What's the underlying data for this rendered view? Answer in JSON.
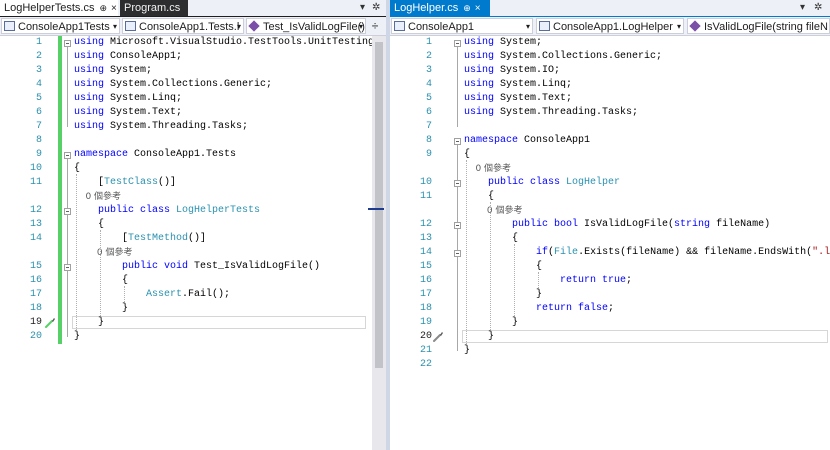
{
  "left_pane": {
    "tabs": [
      {
        "label": "LogHelperTests.cs",
        "active": true
      },
      {
        "label": "Program.cs",
        "active": false
      }
    ],
    "nav": {
      "project": "ConsoleApp1Tests",
      "type": "ConsoleApp1.Tests.l",
      "member": "Test_IsValidLogFile()"
    },
    "lines": [
      {
        "n": "1",
        "tokens": [
          {
            "k": "kw",
            "t": "using"
          },
          {
            "k": "p",
            "t": " Microsoft.VisualStudio.TestTools.UnitTesting;"
          }
        ]
      },
      {
        "n": "2",
        "tokens": [
          {
            "k": "kw",
            "t": "using"
          },
          {
            "k": "p",
            "t": " ConsoleApp1;"
          }
        ]
      },
      {
        "n": "3",
        "tokens": [
          {
            "k": "kw",
            "t": "using"
          },
          {
            "k": "p",
            "t": " System;"
          }
        ]
      },
      {
        "n": "4",
        "tokens": [
          {
            "k": "kw",
            "t": "using"
          },
          {
            "k": "p",
            "t": " System.Collections.Generic;"
          }
        ]
      },
      {
        "n": "5",
        "tokens": [
          {
            "k": "kw",
            "t": "using"
          },
          {
            "k": "p",
            "t": " System.Linq;"
          }
        ]
      },
      {
        "n": "6",
        "tokens": [
          {
            "k": "kw",
            "t": "using"
          },
          {
            "k": "p",
            "t": " System.Text;"
          }
        ]
      },
      {
        "n": "7",
        "tokens": [
          {
            "k": "kw",
            "t": "using"
          },
          {
            "k": "p",
            "t": " System.Threading.Tasks;"
          }
        ]
      },
      {
        "n": "8",
        "tokens": []
      },
      {
        "n": "9",
        "tokens": [
          {
            "k": "kw",
            "t": "namespace"
          },
          {
            "k": "p",
            "t": " ConsoleApp1.Tests"
          }
        ]
      },
      {
        "n": "10",
        "tokens": [
          {
            "k": "p",
            "t": "{"
          }
        ]
      },
      {
        "n": "11",
        "tokens": [
          {
            "k": "p",
            "t": "    ["
          },
          {
            "k": "ty",
            "t": "TestClass"
          },
          {
            "k": "p",
            "t": "()]"
          }
        ]
      },
      {
        "n": "",
        "tokens": [
          {
            "k": "ref",
            "t": "    0 個參考"
          }
        ]
      },
      {
        "n": "12",
        "tokens": [
          {
            "k": "p",
            "t": "    "
          },
          {
            "k": "kw",
            "t": "public class"
          },
          {
            "k": "p",
            "t": " "
          },
          {
            "k": "ty",
            "t": "LogHelperTests"
          }
        ]
      },
      {
        "n": "13",
        "tokens": [
          {
            "k": "p",
            "t": "    {"
          }
        ]
      },
      {
        "n": "14",
        "tokens": [
          {
            "k": "p",
            "t": "        ["
          },
          {
            "k": "ty",
            "t": "TestMethod"
          },
          {
            "k": "p",
            "t": "()]"
          }
        ]
      },
      {
        "n": "",
        "tokens": [
          {
            "k": "ref",
            "t": "        0 個參考"
          }
        ]
      },
      {
        "n": "15",
        "tokens": [
          {
            "k": "p",
            "t": "        "
          },
          {
            "k": "kw",
            "t": "public void"
          },
          {
            "k": "p",
            "t": " Test_IsValidLogFile()"
          }
        ]
      },
      {
        "n": "16",
        "tokens": [
          {
            "k": "p",
            "t": "        {"
          }
        ]
      },
      {
        "n": "17",
        "tokens": [
          {
            "k": "p",
            "t": "            "
          },
          {
            "k": "ty",
            "t": "Assert"
          },
          {
            "k": "p",
            "t": ".Fail();"
          }
        ]
      },
      {
        "n": "18",
        "tokens": [
          {
            "k": "p",
            "t": "        }"
          }
        ]
      },
      {
        "n": "19",
        "tokens": [
          {
            "k": "p",
            "t": "    }"
          }
        ]
      },
      {
        "n": "20",
        "tokens": [
          {
            "k": "p",
            "t": "}"
          }
        ]
      }
    ]
  },
  "right_pane": {
    "tabs": [
      {
        "label": "LogHelper.cs",
        "active": true
      }
    ],
    "nav": {
      "project": "ConsoleApp1",
      "type": "ConsoleApp1.LogHelper",
      "member": "IsValidLogFile(string fileN"
    },
    "lines": [
      {
        "n": "1",
        "tokens": [
          {
            "k": "kw",
            "t": "using"
          },
          {
            "k": "p",
            "t": " System;"
          }
        ]
      },
      {
        "n": "2",
        "tokens": [
          {
            "k": "kw",
            "t": "using"
          },
          {
            "k": "p",
            "t": " System.Collections.Generic;"
          }
        ]
      },
      {
        "n": "3",
        "tokens": [
          {
            "k": "kw",
            "t": "using"
          },
          {
            "k": "p",
            "t": " System.IO;"
          }
        ]
      },
      {
        "n": "4",
        "tokens": [
          {
            "k": "kw",
            "t": "using"
          },
          {
            "k": "p",
            "t": " System.Linq;"
          }
        ]
      },
      {
        "n": "5",
        "tokens": [
          {
            "k": "kw",
            "t": "using"
          },
          {
            "k": "p",
            "t": " System.Text;"
          }
        ]
      },
      {
        "n": "6",
        "tokens": [
          {
            "k": "kw",
            "t": "using"
          },
          {
            "k": "p",
            "t": " System.Threading.Tasks;"
          }
        ]
      },
      {
        "n": "7",
        "tokens": []
      },
      {
        "n": "8",
        "tokens": [
          {
            "k": "kw",
            "t": "namespace"
          },
          {
            "k": "p",
            "t": " ConsoleApp1"
          }
        ]
      },
      {
        "n": "9",
        "tokens": [
          {
            "k": "p",
            "t": "{"
          }
        ]
      },
      {
        "n": "",
        "tokens": [
          {
            "k": "ref",
            "t": "    0 個參考"
          }
        ]
      },
      {
        "n": "10",
        "tokens": [
          {
            "k": "p",
            "t": "    "
          },
          {
            "k": "kw",
            "t": "public class"
          },
          {
            "k": "p",
            "t": " "
          },
          {
            "k": "ty",
            "t": "LogHelper"
          }
        ]
      },
      {
        "n": "11",
        "tokens": [
          {
            "k": "p",
            "t": "    {"
          }
        ]
      },
      {
        "n": "",
        "tokens": [
          {
            "k": "ref",
            "t": "        0 個參考"
          }
        ]
      },
      {
        "n": "12",
        "tokens": [
          {
            "k": "p",
            "t": "        "
          },
          {
            "k": "kw",
            "t": "public bool"
          },
          {
            "k": "p",
            "t": " IsValidLogFile("
          },
          {
            "k": "kw",
            "t": "string"
          },
          {
            "k": "p",
            "t": " fileName)"
          }
        ]
      },
      {
        "n": "13",
        "tokens": [
          {
            "k": "p",
            "t": "        {"
          }
        ]
      },
      {
        "n": "14",
        "tokens": [
          {
            "k": "p",
            "t": "            "
          },
          {
            "k": "kw",
            "t": "if"
          },
          {
            "k": "p",
            "t": "("
          },
          {
            "k": "ty",
            "t": "File"
          },
          {
            "k": "p",
            "t": ".Exists(fileName) && fileName.EndsWith("
          },
          {
            "k": "str",
            "t": "\".log\""
          },
          {
            "k": "p",
            "t": "))"
          }
        ]
      },
      {
        "n": "15",
        "tokens": [
          {
            "k": "p",
            "t": "            {"
          }
        ]
      },
      {
        "n": "16",
        "tokens": [
          {
            "k": "p",
            "t": "                "
          },
          {
            "k": "kw",
            "t": "return true"
          },
          {
            "k": "p",
            "t": ";"
          }
        ]
      },
      {
        "n": "17",
        "tokens": [
          {
            "k": "p",
            "t": "            }"
          }
        ]
      },
      {
        "n": "18",
        "tokens": [
          {
            "k": "p",
            "t": "            "
          },
          {
            "k": "kw",
            "t": "return false"
          },
          {
            "k": "p",
            "t": ";"
          }
        ]
      },
      {
        "n": "19",
        "tokens": [
          {
            "k": "p",
            "t": "        }"
          }
        ]
      },
      {
        "n": "20",
        "tokens": [
          {
            "k": "p",
            "t": "    }"
          }
        ]
      },
      {
        "n": "21",
        "tokens": [
          {
            "k": "p",
            "t": "}"
          }
        ]
      },
      {
        "n": "22",
        "tokens": []
      }
    ]
  },
  "icons": {
    "pin": "pin-icon",
    "close": "close-icon",
    "dropdown": "chevron-down-icon",
    "settings": "gear-icon",
    "split": "split-editor-icon",
    "quick_action": "screwdriver-icon"
  },
  "glyphs": {
    "pin": "⊕",
    "close": "×",
    "dropdown": "▾",
    "gear": "✲",
    "split": "÷",
    "overflow": "▾"
  },
  "colors": {
    "keyword": "#0000ff",
    "type": "#2b91af",
    "string": "#a31515",
    "line_number": "#2b91af",
    "change_bar": "#57d167",
    "active_tab_blue": "#007acc"
  }
}
